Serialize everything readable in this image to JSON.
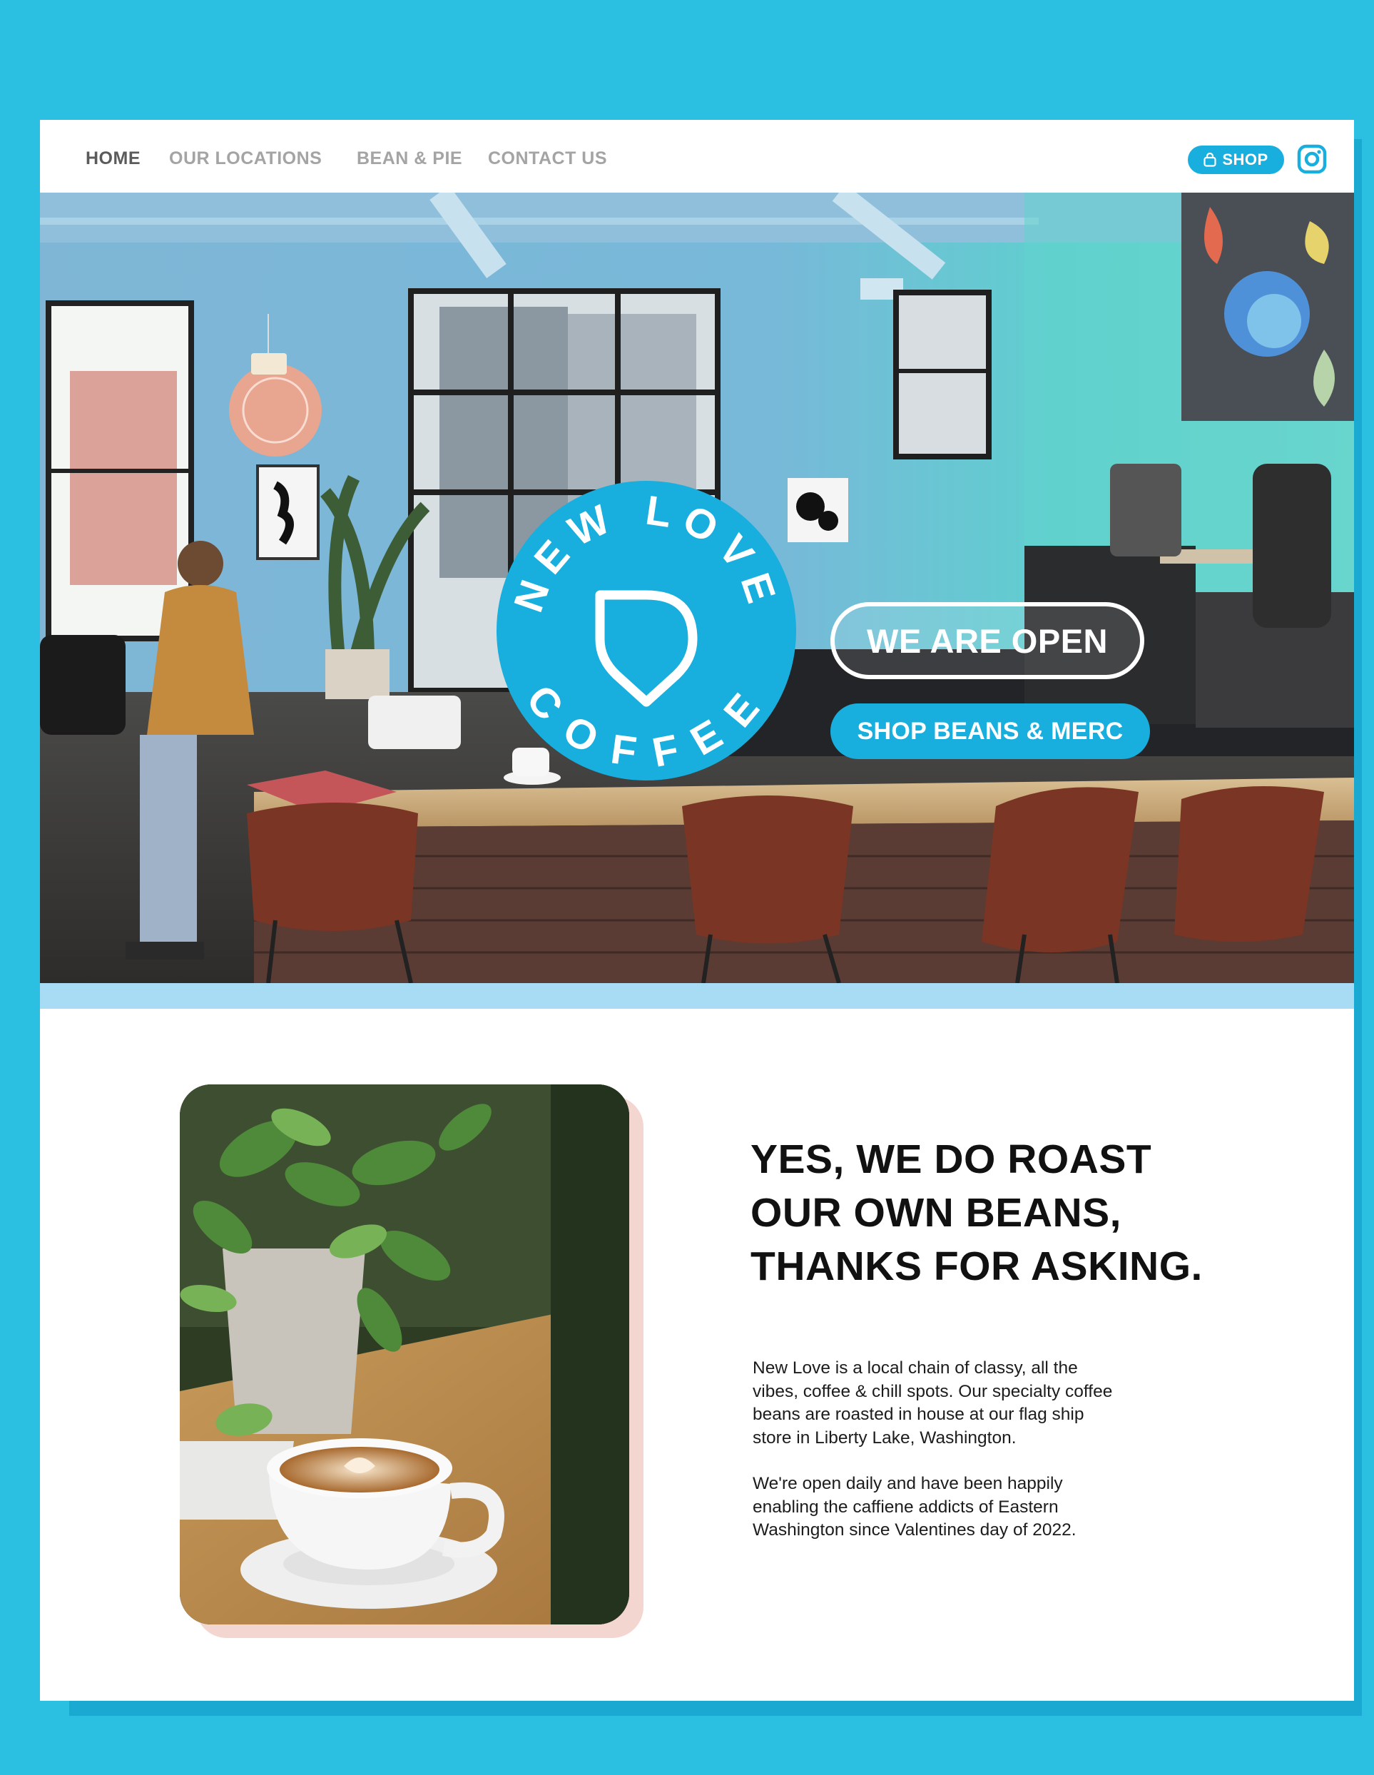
{
  "nav": {
    "links": [
      {
        "label": "HOME",
        "active": true
      },
      {
        "label": "OUR LOCATIONS",
        "active": false
      },
      {
        "label": "BEAN & PIE",
        "active": false
      },
      {
        "label": "CONTACT US",
        "active": false
      }
    ],
    "shop_label": "SHOP",
    "shop_icon": "shopping-bag-icon",
    "social_icon": "instagram-icon"
  },
  "hero": {
    "badge_top": "NEW LOVE",
    "badge_bottom": "COFFEE",
    "badge_icon": "heart-icon",
    "open_label": "WE ARE OPEN",
    "shop_beans_label": "SHOP BEANS & MERC"
  },
  "about": {
    "headline_lines": [
      "YES, WE DO ROAST",
      "OUR OWN BEANS,",
      "THANKS FOR ASKING."
    ],
    "paragraph1_lines": [
      "New Love is a local chain of classy, all the",
      "vibes, coffee & chill spots. Our specialty coffee",
      "beans are roasted in house at our flag ship",
      "store in Liberty Lake, Washington."
    ],
    "paragraph2_lines": [
      "We're open daily and have been happily",
      "enabling the caffiene addicts of Eastern",
      "Washington since Valentines day of 2022."
    ]
  },
  "colors": {
    "background": "#2bbfe2",
    "brand_blue": "#18aede",
    "strip": "#a8dcf5",
    "photo_shadow": "#f4d6d1",
    "text_dark": "#111111",
    "nav_inactive": "#a4a4a4",
    "nav_active": "#5b5b5b"
  }
}
